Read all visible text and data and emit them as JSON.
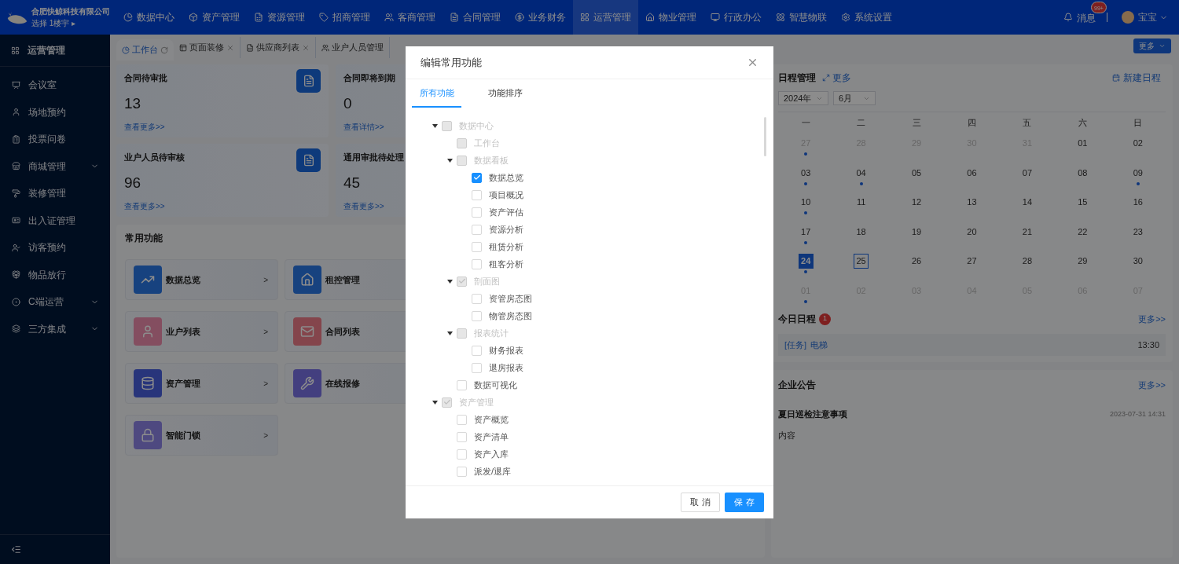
{
  "topbar": {
    "company": "合肥快鲸科技有限公司",
    "building": "选择 1楼宇",
    "building_caret": "▸",
    "nav": [
      {
        "label": "数据中心",
        "selected": false
      },
      {
        "label": "资产管理",
        "selected": false
      },
      {
        "label": "资源管理",
        "selected": false
      },
      {
        "label": "招商管理",
        "selected": false
      },
      {
        "label": "客商管理",
        "selected": false
      },
      {
        "label": "合同管理",
        "selected": false
      },
      {
        "label": "业务财务",
        "selected": false
      },
      {
        "label": "运营管理",
        "selected": true
      },
      {
        "label": "物业管理",
        "selected": false
      },
      {
        "label": "行政办公",
        "selected": false
      },
      {
        "label": "智慧物联",
        "selected": false
      },
      {
        "label": "系统设置",
        "selected": false
      }
    ],
    "messages": "消息",
    "badge": "99+",
    "user": "宝宝"
  },
  "sidebar": {
    "title": "运营管理",
    "items": [
      {
        "label": "会议室",
        "kind": "link"
      },
      {
        "label": "场地预约",
        "kind": "link"
      },
      {
        "label": "投票问卷",
        "kind": "link"
      },
      {
        "label": "商城管理",
        "kind": "group"
      },
      {
        "label": "装修管理",
        "kind": "link"
      },
      {
        "label": "出入证管理",
        "kind": "link"
      },
      {
        "label": "访客预约",
        "kind": "link"
      },
      {
        "label": "物品放行",
        "kind": "link"
      },
      {
        "label": "C端运营",
        "kind": "group"
      },
      {
        "label": "三方集成",
        "kind": "group"
      }
    ]
  },
  "page_tabs": [
    {
      "label": "工作台",
      "selected": true
    },
    {
      "label": "页面装修",
      "selected": false
    },
    {
      "label": "供应商列表",
      "selected": false
    },
    {
      "label": "业户人员管理",
      "selected": false
    }
  ],
  "more_button": "更多",
  "stats": [
    {
      "title": "合同待审批",
      "value": "13",
      "link": "查看更多>>"
    },
    {
      "title": "合同即将到期",
      "value": "0",
      "link": "查看详情>>"
    },
    {
      "title": "业户人员待审核",
      "value": "96",
      "link": "查看更多>>"
    },
    {
      "title": "通用审批待处理",
      "value": "45",
      "link": "查看更多>>"
    }
  ],
  "functions": {
    "title": "常用功能",
    "items": [
      {
        "label": "数据总览",
        "kind": "chart",
        "arrow": ">"
      },
      {
        "label": "租控管理",
        "kind": "house"
      },
      {
        "label": "业户列表",
        "kind": "person",
        "arrow": ">"
      },
      {
        "label": "合同列表",
        "kind": "mail"
      },
      {
        "label": "资产管理",
        "kind": "database",
        "arrow": ">"
      },
      {
        "label": "在线报修",
        "kind": "tools"
      },
      {
        "label": "智能门锁",
        "kind": "lock",
        "arrow": ">"
      }
    ]
  },
  "schedule": {
    "title": "日程管理",
    "expand": "更多",
    "new": "新建日程",
    "year": "2024年",
    "month": "6月",
    "weekdays": [
      "一",
      "二",
      "三",
      "四",
      "五",
      "六",
      "日"
    ],
    "days": [
      {
        "label": "27",
        "other": true,
        "dot": true,
        "selected": false,
        "today": false
      },
      {
        "label": "28",
        "other": true,
        "dot": false,
        "selected": false,
        "today": false
      },
      {
        "label": "29",
        "other": true,
        "dot": false,
        "selected": false,
        "today": false
      },
      {
        "label": "30",
        "other": true,
        "dot": false,
        "selected": false,
        "today": false
      },
      {
        "label": "31",
        "other": true,
        "dot": false,
        "selected": false,
        "today": false
      },
      {
        "label": "01",
        "other": false,
        "dot": false,
        "selected": false,
        "today": false
      },
      {
        "label": "02",
        "other": false,
        "dot": false,
        "selected": false,
        "today": false
      },
      {
        "label": "03",
        "other": false,
        "dot": true,
        "selected": false,
        "today": false
      },
      {
        "label": "04",
        "other": false,
        "dot": true,
        "selected": false,
        "today": false
      },
      {
        "label": "05",
        "other": false,
        "dot": false,
        "selected": false,
        "today": false
      },
      {
        "label": "06",
        "other": false,
        "dot": false,
        "selected": false,
        "today": false
      },
      {
        "label": "07",
        "other": false,
        "dot": false,
        "selected": false,
        "today": false
      },
      {
        "label": "08",
        "other": false,
        "dot": false,
        "selected": false,
        "today": false
      },
      {
        "label": "09",
        "other": false,
        "dot": true,
        "selected": false,
        "today": false
      },
      {
        "label": "10",
        "other": false,
        "dot": true,
        "selected": false,
        "today": false
      },
      {
        "label": "11",
        "other": false,
        "dot": false,
        "selected": false,
        "today": false
      },
      {
        "label": "12",
        "other": false,
        "dot": false,
        "selected": false,
        "today": false
      },
      {
        "label": "13",
        "other": false,
        "dot": false,
        "selected": false,
        "today": false
      },
      {
        "label": "14",
        "other": false,
        "dot": false,
        "selected": false,
        "today": false
      },
      {
        "label": "15",
        "other": false,
        "dot": false,
        "selected": false,
        "today": false
      },
      {
        "label": "16",
        "other": false,
        "dot": false,
        "selected": false,
        "today": false
      },
      {
        "label": "17",
        "other": false,
        "dot": true,
        "selected": false,
        "today": false
      },
      {
        "label": "18",
        "other": false,
        "dot": false,
        "selected": false,
        "today": false
      },
      {
        "label": "19",
        "other": false,
        "dot": false,
        "selected": false,
        "today": false
      },
      {
        "label": "20",
        "other": false,
        "dot": false,
        "selected": false,
        "today": false
      },
      {
        "label": "21",
        "other": false,
        "dot": false,
        "selected": false,
        "today": false
      },
      {
        "label": "22",
        "other": false,
        "dot": false,
        "selected": false,
        "today": false
      },
      {
        "label": "23",
        "other": false,
        "dot": false,
        "selected": false,
        "today": false
      },
      {
        "label": "24",
        "other": false,
        "dot": true,
        "selected": true,
        "today": false
      },
      {
        "label": "25",
        "other": false,
        "dot": false,
        "selected": false,
        "today": true
      },
      {
        "label": "26",
        "other": false,
        "dot": false,
        "selected": false,
        "today": false
      },
      {
        "label": "27",
        "other": false,
        "dot": false,
        "selected": false,
        "today": false
      },
      {
        "label": "28",
        "other": false,
        "dot": false,
        "selected": false,
        "today": false
      },
      {
        "label": "29",
        "other": false,
        "dot": false,
        "selected": false,
        "today": false
      },
      {
        "label": "30",
        "other": false,
        "dot": false,
        "selected": false,
        "today": false
      },
      {
        "label": "01",
        "other": true,
        "dot": true,
        "selected": false,
        "today": false
      },
      {
        "label": "02",
        "other": true,
        "dot": false,
        "selected": false,
        "today": false
      },
      {
        "label": "03",
        "other": true,
        "dot": false,
        "selected": false,
        "today": false
      },
      {
        "label": "04",
        "other": true,
        "dot": false,
        "selected": false,
        "today": false
      },
      {
        "label": "05",
        "other": true,
        "dot": false,
        "selected": false,
        "today": false
      },
      {
        "label": "06",
        "other": true,
        "dot": false,
        "selected": false,
        "today": false
      },
      {
        "label": "07",
        "other": true,
        "dot": false,
        "selected": false,
        "today": false
      }
    ]
  },
  "today": {
    "title": "今日日程",
    "count": "1",
    "more": "更多>>",
    "items": [
      {
        "tag": "[任务]",
        "text": "电梯",
        "time": "13:30"
      }
    ]
  },
  "notices": {
    "title": "企业公告",
    "more": "更多>>",
    "items": [
      {
        "title": "夏日巡检注意事项",
        "date": "2023-07-31 14:31",
        "body": "内容"
      }
    ]
  },
  "modal": {
    "title": "编辑常用功能",
    "tabs": [
      {
        "label": "所有功能",
        "selected": true
      },
      {
        "label": "功能排序",
        "selected": false
      }
    ],
    "tree": [
      {
        "label": "数据中心",
        "checked": false,
        "disabled": true,
        "expanded": true,
        "children": [
          {
            "label": "工作台",
            "checked": false,
            "disabled": true
          },
          {
            "label": "数据看板",
            "checked": false,
            "disabled": true,
            "expanded": true,
            "children": [
              {
                "label": "数据总览",
                "checked": true,
                "disabled": false
              },
              {
                "label": "项目概况",
                "checked": false,
                "disabled": false
              },
              {
                "label": "资产评估",
                "checked": false,
                "disabled": false
              },
              {
                "label": "资源分析",
                "checked": false,
                "disabled": false
              },
              {
                "label": "租赁分析",
                "checked": false,
                "disabled": false
              },
              {
                "label": "租客分析",
                "checked": false,
                "disabled": false
              }
            ]
          },
          {
            "label": "剖面图",
            "checked": true,
            "disabled": true,
            "expanded": true,
            "children": [
              {
                "label": "资管房态图",
                "checked": false,
                "disabled": false
              },
              {
                "label": "物管房态图",
                "checked": false,
                "disabled": false
              }
            ]
          },
          {
            "label": "报表统计",
            "checked": false,
            "disabled": true,
            "expanded": true,
            "children": [
              {
                "label": "财务报表",
                "checked": false,
                "disabled": false
              },
              {
                "label": "退房报表",
                "checked": false,
                "disabled": false
              }
            ]
          },
          {
            "label": "数据可视化",
            "checked": false,
            "disabled": false
          }
        ]
      },
      {
        "label": "资产管理",
        "checked": true,
        "disabled": true,
        "expanded": true,
        "children": [
          {
            "label": "资产概览",
            "checked": false,
            "disabled": false
          },
          {
            "label": "资产清单",
            "checked": false,
            "disabled": false
          },
          {
            "label": "资产入库",
            "checked": false,
            "disabled": false
          },
          {
            "label": "派发/退库",
            "checked": false,
            "disabled": false
          }
        ]
      }
    ],
    "cancel": "取 消",
    "save": "保 存"
  }
}
